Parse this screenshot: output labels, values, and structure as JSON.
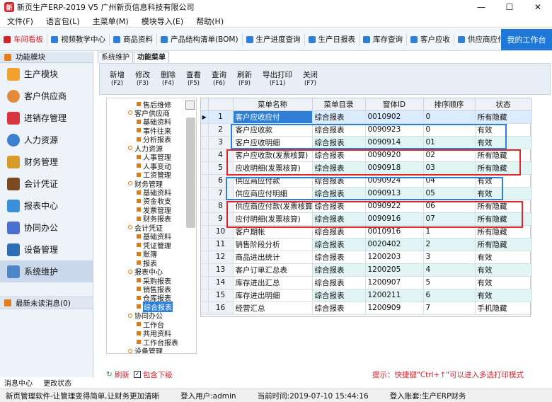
{
  "window": {
    "title": "新页生产ERP-2019 V5 广州新页信息科技有限公司",
    "logo_text": "新"
  },
  "menu": [
    "文件(F)",
    "语言包(L)",
    "主菜单(M)",
    "模块导入(E)",
    "帮助(H)"
  ],
  "quickbar": [
    "车间看板",
    "视频教学中心",
    "商品资料",
    "产品结构清单(BOM)",
    "生产进度查询",
    "生产日报表",
    "库存查询",
    "客户应收",
    "供应商应付"
  ],
  "workbench": "我的工作台",
  "sidebar": {
    "header": "功能模块",
    "modules": [
      "生产模块",
      "客户供应商",
      "进销存管理",
      "人力资源",
      "财务管理",
      "会计凭证",
      "报表中心",
      "协同办公",
      "设备管理",
      "系统维护"
    ],
    "selected": "系统维护",
    "messages": "最新未读消息(0)"
  },
  "bottom_left": [
    "消息中心",
    "更改状态"
  ],
  "tabs": [
    "系统维护",
    "功能菜单"
  ],
  "toolbar": [
    {
      "label": "新增",
      "key": "(F2)"
    },
    {
      "label": "修改",
      "key": "(F3)"
    },
    {
      "label": "删除",
      "key": "(F4)"
    },
    {
      "label": "查看",
      "key": "(F5)"
    },
    {
      "label": "查询",
      "key": "(F6)"
    },
    {
      "label": "刷新",
      "key": "(F9)"
    },
    {
      "label": "导出打印",
      "key": "(F11)"
    },
    {
      "label": "关闭",
      "key": "(F7)"
    }
  ],
  "tree": [
    "售后维修",
    "客户供应商",
    "基础资料",
    "事件往来",
    "分析报表",
    "人力资源",
    "人事管理",
    "人事变动",
    "工资管理",
    "财务管理",
    "基础资料",
    "资金收支",
    "发票管理",
    "财务报表",
    "会计凭证",
    "基础资料",
    "凭证管理",
    "账簿",
    "报表",
    "报表中心",
    "采购报表",
    "销售报表",
    "仓库报表",
    "综合报表",
    "协同办公",
    "工作台",
    "共用资料",
    "工作台报表",
    "设备管理"
  ],
  "grid": {
    "columns": [
      "菜单名称",
      "菜单目录",
      "窗体ID",
      "排序顺序",
      "状态"
    ],
    "rows": [
      [
        "1",
        "客户应收应付",
        "综合报表",
        "0010902",
        "0",
        "所有隐藏"
      ],
      [
        "2",
        "客户应收款",
        "综合报表",
        "0090923",
        "0",
        "有效"
      ],
      [
        "3",
        "客户应收明细",
        "综合报表",
        "0090914",
        "01",
        "有效"
      ],
      [
        "4",
        "客户应收款(发票核算)",
        "综合报表",
        "0090920",
        "02",
        "所有隐藏"
      ],
      [
        "5",
        "应收明细(发票核算)",
        "综合报表",
        "0090918",
        "03",
        "所有隐藏"
      ],
      [
        "6",
        "供应商应付款",
        "综合报表",
        "0090924",
        "04",
        "有效"
      ],
      [
        "7",
        "供应商应付明细",
        "综合报表",
        "0090913",
        "05",
        "有效"
      ],
      [
        "8",
        "供应商应付款(发票核算)",
        "综合报表",
        "0090922",
        "06",
        "所有隐藏"
      ],
      [
        "9",
        "应付明细(发票核算)",
        "综合报表",
        "0090916",
        "07",
        "所有隐藏"
      ],
      [
        "10",
        "客户期帐",
        "综合报表",
        "0010916",
        "1",
        "所有隐藏"
      ],
      [
        "11",
        "销售阶段分析",
        "综合报表",
        "0020402",
        "2",
        "所有隐藏"
      ],
      [
        "12",
        "商品进出统计",
        "综合报表",
        "1200203",
        "3",
        "有效"
      ],
      [
        "13",
        "客户订单汇总表",
        "综合报表",
        "1200205",
        "4",
        "有效"
      ],
      [
        "14",
        "库存进出汇总",
        "综合报表",
        "1200907",
        "5",
        "有效"
      ],
      [
        "15",
        "库存进出明细",
        "综合报表",
        "1200211",
        "6",
        "有效"
      ],
      [
        "16",
        "经营汇总",
        "综合报表",
        "1200909",
        "7",
        "手机隐藏"
      ]
    ]
  },
  "bottombar": {
    "refresh": "刷新",
    "include_sub": "包含下级",
    "hint": "提示：快捷键\"Ctrl+↑\"可以进入多选打印模式"
  },
  "status": [
    "新页管理软件-让管理变得简单,让财务更加清晰",
    "登入用户:admin",
    "当前时间:2019-07-10 15:44:16",
    "登入账套:生产ERP财务"
  ],
  "colors": {
    "accent": "#2f7fd6",
    "annotation_red": "#e0262b",
    "annotation_blue": "#2f7fd6",
    "workbench": "#1e78d8"
  }
}
